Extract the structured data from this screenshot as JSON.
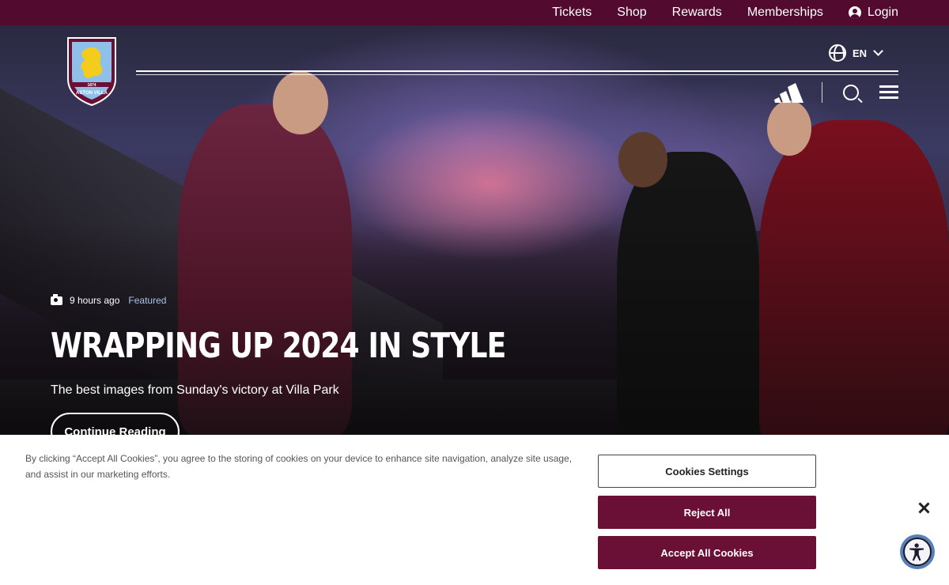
{
  "topnav": {
    "items": [
      "Tickets",
      "Shop",
      "Rewards",
      "Memberships"
    ],
    "login": "Login"
  },
  "header": {
    "crest_text": "ASTON VILLA",
    "crest_year": "1874",
    "language": "EN",
    "icons": [
      "adidas-logo",
      "search-icon",
      "menu-icon",
      "globe-icon"
    ]
  },
  "hero": {
    "time": "9 hours ago",
    "tag": "Featured",
    "title": "Wrapping up 2024 in style",
    "subtitle": "The best images from Sunday's victory at Villa Park",
    "cta": "Continue Reading"
  },
  "cookies": {
    "text": "By clicking “Accept All Cookies”, you agree to the storing of cookies on your device to enhance site navigation, analyze site usage, and assist in our marketing efforts.",
    "settings": "Cookies Settings",
    "reject": "Reject All",
    "accept": "Accept All Cookies"
  },
  "colors": {
    "brand_claret": "#520a2f",
    "button_claret": "#6a0f35",
    "sky_blue": "#a8c4e8"
  }
}
